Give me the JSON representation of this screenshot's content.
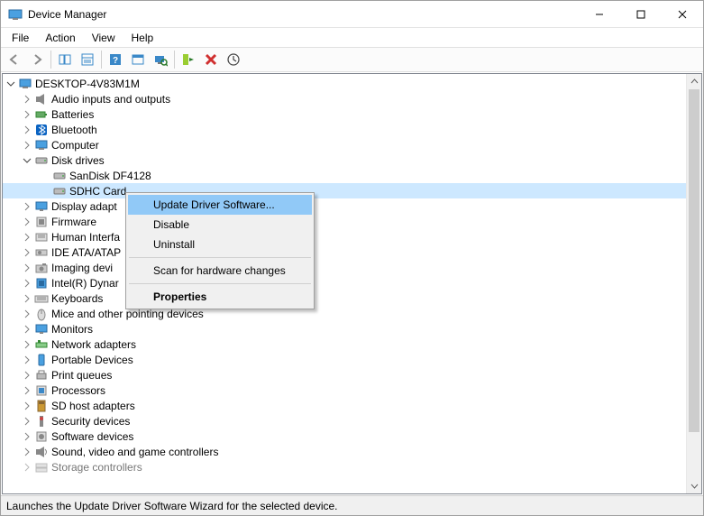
{
  "window": {
    "title": "Device Manager"
  },
  "menu": {
    "file": "File",
    "action": "Action",
    "view": "View",
    "help": "Help"
  },
  "tree": {
    "root": "DESKTOP-4V83M1M",
    "items": [
      {
        "label": "Audio inputs and outputs",
        "icon": "speaker"
      },
      {
        "label": "Batteries",
        "icon": "battery"
      },
      {
        "label": "Bluetooth",
        "icon": "bluetooth"
      },
      {
        "label": "Computer",
        "icon": "computer"
      },
      {
        "label": "Disk drives",
        "icon": "disk",
        "expanded": true,
        "children": [
          {
            "label": "SanDisk DF4128",
            "icon": "disk"
          },
          {
            "label": "SDHC Card",
            "icon": "disk",
            "selected": true
          }
        ]
      },
      {
        "label": "Display adapt",
        "icon": "display",
        "truncated": true
      },
      {
        "label": "Firmware",
        "icon": "chip"
      },
      {
        "label": "Human Interfa",
        "icon": "hid",
        "truncated": true
      },
      {
        "label": "IDE ATA/ATAP",
        "icon": "ide",
        "truncated": true
      },
      {
        "label": "Imaging devi",
        "icon": "camera",
        "truncated": true
      },
      {
        "label": "Intel(R) Dynar",
        "icon": "cpu",
        "truncated": true
      },
      {
        "label": "Keyboards",
        "icon": "keyboard"
      },
      {
        "label": "Mice and other pointing devices",
        "icon": "mouse"
      },
      {
        "label": "Monitors",
        "icon": "monitor"
      },
      {
        "label": "Network adapters",
        "icon": "network"
      },
      {
        "label": "Portable Devices",
        "icon": "portable"
      },
      {
        "label": "Print queues",
        "icon": "printer"
      },
      {
        "label": "Processors",
        "icon": "processor"
      },
      {
        "label": "SD host adapters",
        "icon": "sd"
      },
      {
        "label": "Security devices",
        "icon": "security"
      },
      {
        "label": "Software devices",
        "icon": "software"
      },
      {
        "label": "Sound, video and game controllers",
        "icon": "sound"
      },
      {
        "label": "Storage controllers",
        "icon": "storage",
        "dimmed": true
      }
    ]
  },
  "context_menu": {
    "update": "Update Driver Software...",
    "disable": "Disable",
    "uninstall": "Uninstall",
    "scan": "Scan for hardware changes",
    "properties": "Properties"
  },
  "status": "Launches the Update Driver Software Wizard for the selected device."
}
